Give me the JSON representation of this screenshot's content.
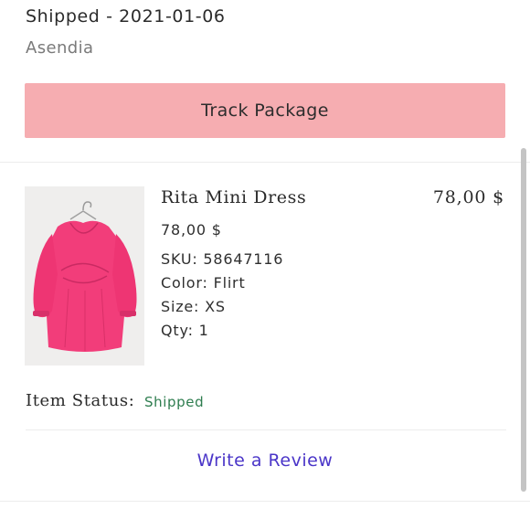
{
  "shipment": {
    "status_line": "Shipped - 2021-01-06",
    "carrier": "Asendia",
    "track_button_label": "Track Package"
  },
  "item": {
    "name": "Rita Mini Dress",
    "line_total": "78,00  $",
    "unit_price": "78,00 $",
    "sku": "SKU: 58647116",
    "color": "Color: Flirt",
    "size": "Size: XS",
    "qty": "Qty: 1",
    "image_icon": "pink-dress-product-photo"
  },
  "status": {
    "label": "Item Status:",
    "value": "Shipped"
  },
  "review": {
    "link_label": "Write a Review"
  },
  "colors": {
    "track_button_bg": "#f6adb1",
    "status_green": "#2e7d4f",
    "link_purple": "#4a35c8",
    "dress_pink": "#f23d7a"
  }
}
